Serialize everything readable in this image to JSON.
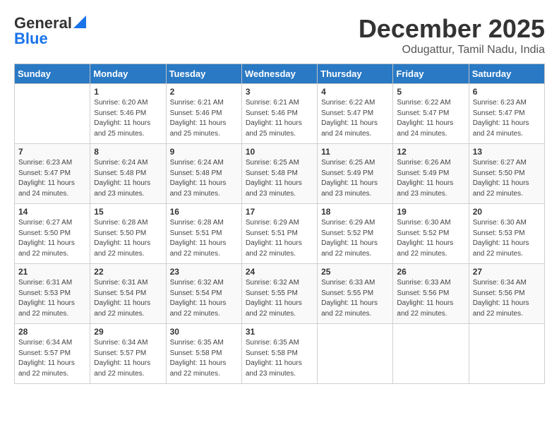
{
  "logo": {
    "line1": "General",
    "line2": "Blue"
  },
  "title": "December 2025",
  "subtitle": "Odugattur, Tamil Nadu, India",
  "days_header": [
    "Sunday",
    "Monday",
    "Tuesday",
    "Wednesday",
    "Thursday",
    "Friday",
    "Saturday"
  ],
  "weeks": [
    [
      {
        "day": "",
        "sunrise": "",
        "sunset": "",
        "daylight": ""
      },
      {
        "day": "1",
        "sunrise": "Sunrise: 6:20 AM",
        "sunset": "Sunset: 5:46 PM",
        "daylight": "Daylight: 11 hours and 25 minutes."
      },
      {
        "day": "2",
        "sunrise": "Sunrise: 6:21 AM",
        "sunset": "Sunset: 5:46 PM",
        "daylight": "Daylight: 11 hours and 25 minutes."
      },
      {
        "day": "3",
        "sunrise": "Sunrise: 6:21 AM",
        "sunset": "Sunset: 5:46 PM",
        "daylight": "Daylight: 11 hours and 25 minutes."
      },
      {
        "day": "4",
        "sunrise": "Sunrise: 6:22 AM",
        "sunset": "Sunset: 5:47 PM",
        "daylight": "Daylight: 11 hours and 24 minutes."
      },
      {
        "day": "5",
        "sunrise": "Sunrise: 6:22 AM",
        "sunset": "Sunset: 5:47 PM",
        "daylight": "Daylight: 11 hours and 24 minutes."
      },
      {
        "day": "6",
        "sunrise": "Sunrise: 6:23 AM",
        "sunset": "Sunset: 5:47 PM",
        "daylight": "Daylight: 11 hours and 24 minutes."
      }
    ],
    [
      {
        "day": "7",
        "sunrise": "Sunrise: 6:23 AM",
        "sunset": "Sunset: 5:47 PM",
        "daylight": "Daylight: 11 hours and 24 minutes."
      },
      {
        "day": "8",
        "sunrise": "Sunrise: 6:24 AM",
        "sunset": "Sunset: 5:48 PM",
        "daylight": "Daylight: 11 hours and 23 minutes."
      },
      {
        "day": "9",
        "sunrise": "Sunrise: 6:24 AM",
        "sunset": "Sunset: 5:48 PM",
        "daylight": "Daylight: 11 hours and 23 minutes."
      },
      {
        "day": "10",
        "sunrise": "Sunrise: 6:25 AM",
        "sunset": "Sunset: 5:48 PM",
        "daylight": "Daylight: 11 hours and 23 minutes."
      },
      {
        "day": "11",
        "sunrise": "Sunrise: 6:25 AM",
        "sunset": "Sunset: 5:49 PM",
        "daylight": "Daylight: 11 hours and 23 minutes."
      },
      {
        "day": "12",
        "sunrise": "Sunrise: 6:26 AM",
        "sunset": "Sunset: 5:49 PM",
        "daylight": "Daylight: 11 hours and 23 minutes."
      },
      {
        "day": "13",
        "sunrise": "Sunrise: 6:27 AM",
        "sunset": "Sunset: 5:50 PM",
        "daylight": "Daylight: 11 hours and 22 minutes."
      }
    ],
    [
      {
        "day": "14",
        "sunrise": "Sunrise: 6:27 AM",
        "sunset": "Sunset: 5:50 PM",
        "daylight": "Daylight: 11 hours and 22 minutes."
      },
      {
        "day": "15",
        "sunrise": "Sunrise: 6:28 AM",
        "sunset": "Sunset: 5:50 PM",
        "daylight": "Daylight: 11 hours and 22 minutes."
      },
      {
        "day": "16",
        "sunrise": "Sunrise: 6:28 AM",
        "sunset": "Sunset: 5:51 PM",
        "daylight": "Daylight: 11 hours and 22 minutes."
      },
      {
        "day": "17",
        "sunrise": "Sunrise: 6:29 AM",
        "sunset": "Sunset: 5:51 PM",
        "daylight": "Daylight: 11 hours and 22 minutes."
      },
      {
        "day": "18",
        "sunrise": "Sunrise: 6:29 AM",
        "sunset": "Sunset: 5:52 PM",
        "daylight": "Daylight: 11 hours and 22 minutes."
      },
      {
        "day": "19",
        "sunrise": "Sunrise: 6:30 AM",
        "sunset": "Sunset: 5:52 PM",
        "daylight": "Daylight: 11 hours and 22 minutes."
      },
      {
        "day": "20",
        "sunrise": "Sunrise: 6:30 AM",
        "sunset": "Sunset: 5:53 PM",
        "daylight": "Daylight: 11 hours and 22 minutes."
      }
    ],
    [
      {
        "day": "21",
        "sunrise": "Sunrise: 6:31 AM",
        "sunset": "Sunset: 5:53 PM",
        "daylight": "Daylight: 11 hours and 22 minutes."
      },
      {
        "day": "22",
        "sunrise": "Sunrise: 6:31 AM",
        "sunset": "Sunset: 5:54 PM",
        "daylight": "Daylight: 11 hours and 22 minutes."
      },
      {
        "day": "23",
        "sunrise": "Sunrise: 6:32 AM",
        "sunset": "Sunset: 5:54 PM",
        "daylight": "Daylight: 11 hours and 22 minutes."
      },
      {
        "day": "24",
        "sunrise": "Sunrise: 6:32 AM",
        "sunset": "Sunset: 5:55 PM",
        "daylight": "Daylight: 11 hours and 22 minutes."
      },
      {
        "day": "25",
        "sunrise": "Sunrise: 6:33 AM",
        "sunset": "Sunset: 5:55 PM",
        "daylight": "Daylight: 11 hours and 22 minutes."
      },
      {
        "day": "26",
        "sunrise": "Sunrise: 6:33 AM",
        "sunset": "Sunset: 5:56 PM",
        "daylight": "Daylight: 11 hours and 22 minutes."
      },
      {
        "day": "27",
        "sunrise": "Sunrise: 6:34 AM",
        "sunset": "Sunset: 5:56 PM",
        "daylight": "Daylight: 11 hours and 22 minutes."
      }
    ],
    [
      {
        "day": "28",
        "sunrise": "Sunrise: 6:34 AM",
        "sunset": "Sunset: 5:57 PM",
        "daylight": "Daylight: 11 hours and 22 minutes."
      },
      {
        "day": "29",
        "sunrise": "Sunrise: 6:34 AM",
        "sunset": "Sunset: 5:57 PM",
        "daylight": "Daylight: 11 hours and 22 minutes."
      },
      {
        "day": "30",
        "sunrise": "Sunrise: 6:35 AM",
        "sunset": "Sunset: 5:58 PM",
        "daylight": "Daylight: 11 hours and 22 minutes."
      },
      {
        "day": "31",
        "sunrise": "Sunrise: 6:35 AM",
        "sunset": "Sunset: 5:58 PM",
        "daylight": "Daylight: 11 hours and 23 minutes."
      },
      {
        "day": "",
        "sunrise": "",
        "sunset": "",
        "daylight": ""
      },
      {
        "day": "",
        "sunrise": "",
        "sunset": "",
        "daylight": ""
      },
      {
        "day": "",
        "sunrise": "",
        "sunset": "",
        "daylight": ""
      }
    ]
  ]
}
